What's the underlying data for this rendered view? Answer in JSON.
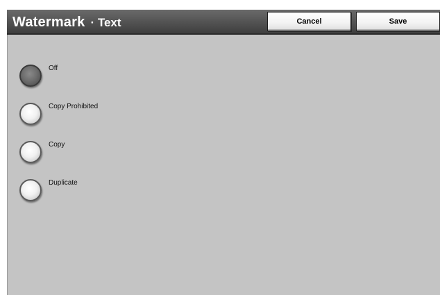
{
  "header": {
    "title": "Watermark",
    "subtitle": "· Text",
    "cancel_label": "Cancel",
    "save_label": "Save"
  },
  "options": [
    {
      "label": "Off",
      "selected": true
    },
    {
      "label": "Copy Prohibited",
      "selected": false
    },
    {
      "label": "Copy",
      "selected": false
    },
    {
      "label": "Duplicate",
      "selected": false
    }
  ],
  "colors": {
    "panel_background": "#c4c4c4",
    "title_bar": "#4a4a4a",
    "selected_radio": "#666666"
  }
}
